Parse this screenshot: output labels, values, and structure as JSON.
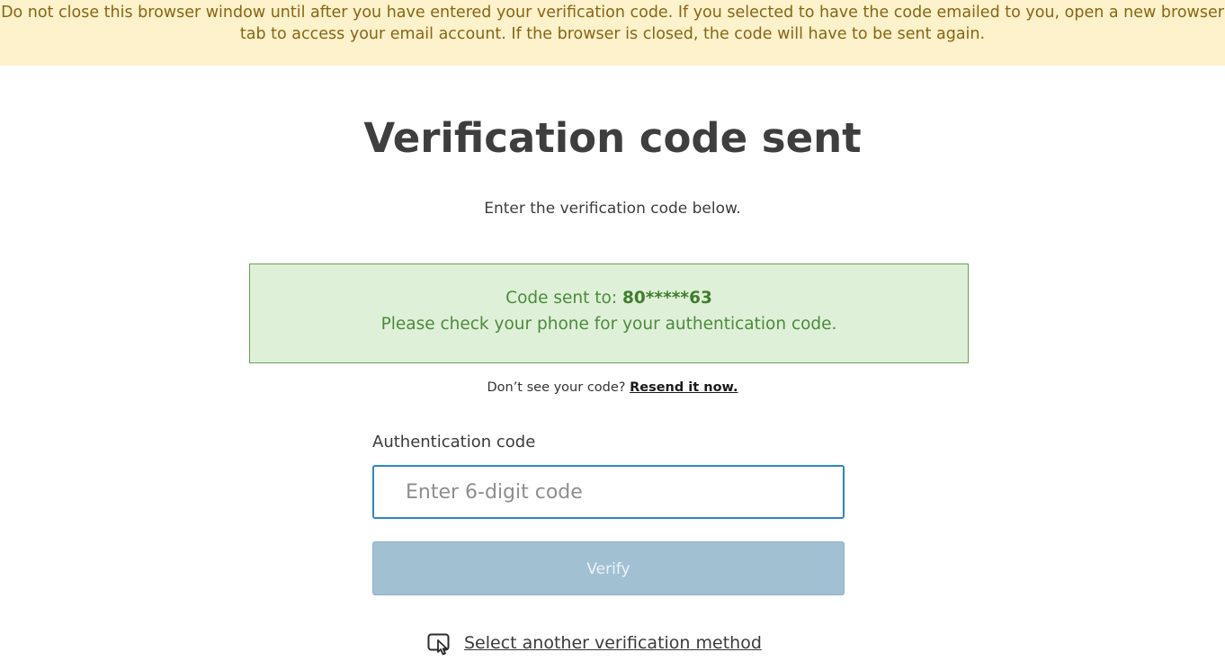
{
  "banner": {
    "text": "Do not close this browser window until after you have entered your verification code. If you selected to have the code emailed to you, open a new browser tab to access your email account. If the browser is closed, the code will have to be sent again."
  },
  "page": {
    "title": "Verification code sent",
    "instructions": "Enter the verification code below."
  },
  "success_message": {
    "prefix": "Code sent to: ",
    "masked_number": "80*****63",
    "detail": "Please check your phone for your authentication code."
  },
  "resend": {
    "prompt": "Don’t see your code?",
    "link_label": "Resend it now."
  },
  "form": {
    "label": "Authentication code",
    "value": "",
    "placeholder": "Enter 6-digit code",
    "verify_label": "Verify",
    "verify_disabled": true
  },
  "alternate": {
    "icon": "touch-select-icon",
    "label": "Select another verification method"
  },
  "colors": {
    "banner_bg": "#fdf2cb",
    "banner_text": "#8a6415",
    "success_bg": "#dff0d8",
    "success_text": "#4b8a3c",
    "input_border": "#2f84c9",
    "verify_bg": "#a1c0d2"
  }
}
